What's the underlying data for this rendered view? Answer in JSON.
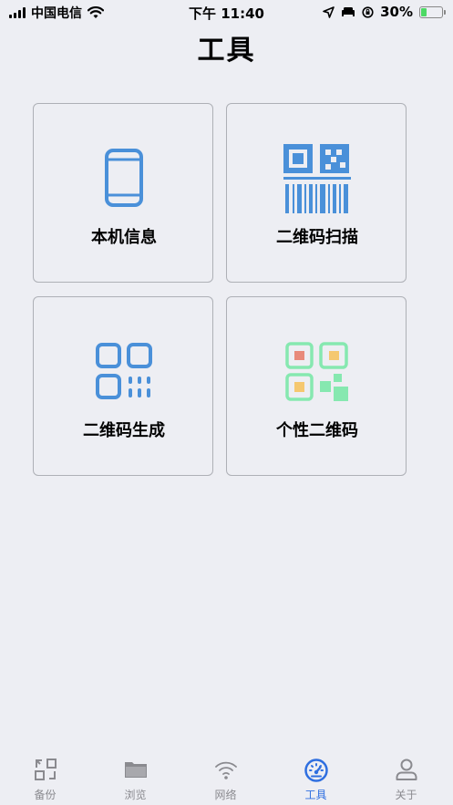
{
  "status_bar": {
    "carrier": "中国电信",
    "time": "下午 11:40",
    "battery_percent": "30%",
    "battery_level": 0.3
  },
  "page_title": "工具",
  "tools": [
    {
      "label": "本机信息",
      "icon": "phone-icon"
    },
    {
      "label": "二维码扫描",
      "icon": "barcode-scan-icon"
    },
    {
      "label": "二维码生成",
      "icon": "qr-generate-icon"
    },
    {
      "label": "个性二维码",
      "icon": "custom-qr-icon"
    }
  ],
  "colors": {
    "icon_blue": "#4a90d9",
    "active_tab": "#2f6fe0",
    "inactive_tab": "#8a8a8f",
    "custom_qr_green": "#86e8b0",
    "custom_qr_red": "#e88a7a",
    "custom_qr_yellow": "#f5c870"
  },
  "tab_bar": {
    "items": [
      {
        "label": "备份",
        "icon": "backup-icon",
        "active": false
      },
      {
        "label": "浏览",
        "icon": "folder-icon",
        "active": false
      },
      {
        "label": "网络",
        "icon": "wifi-icon",
        "active": false
      },
      {
        "label": "工具",
        "icon": "dashboard-icon",
        "active": true
      },
      {
        "label": "关于",
        "icon": "person-icon",
        "active": false
      }
    ]
  }
}
